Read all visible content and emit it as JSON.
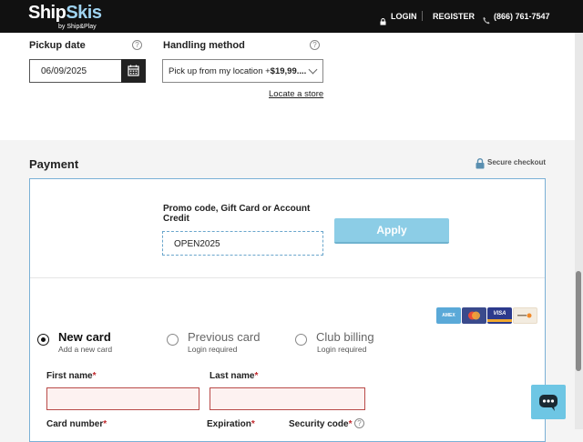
{
  "header": {
    "brand_main": "Ship",
    "brand_accent": "Skis",
    "brand_sub": "by Ship&Play",
    "login": "LOGIN",
    "register": "REGISTER",
    "phone": "(866) 761-7547"
  },
  "pickup": {
    "pickup_label": "Pickup date",
    "pickup_value": "06/09/2025",
    "handling_label": "Handling method",
    "handling_value": "Pick up from my location +",
    "handling_price": "$19,99....",
    "locate_link": "Locate a store"
  },
  "payment": {
    "title": "Payment",
    "secure": "Secure checkout",
    "promo_label": "Promo code, Gift Card or Account Credit",
    "promo_value": "OPEN2025",
    "apply_label": "Apply",
    "card_logos": [
      "AMEX",
      "",
      "VISA",
      ""
    ],
    "options": [
      {
        "title": "New card",
        "sub": "Add a new card",
        "selected": true
      },
      {
        "title": "Previous card",
        "sub": "Login required",
        "selected": false
      },
      {
        "title": "Club billing",
        "sub": "Login required",
        "selected": false
      }
    ],
    "first_name_label": "First name",
    "last_name_label": "Last name",
    "card_number_label": "Card number",
    "expiration_label": "Expiration",
    "security_code_label": "Security code",
    "required_mark": "*"
  },
  "colors": {
    "accent": "#8ccde6",
    "error_border": "#b94a48",
    "panel_border": "#7ab0d6"
  }
}
